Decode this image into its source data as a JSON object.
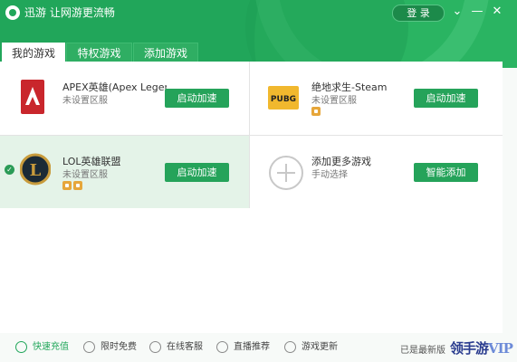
{
  "window": {
    "title": "迅游 让网游更流畅",
    "login_label": "登 录"
  },
  "tabs": [
    {
      "label": "我的游戏",
      "active": true
    },
    {
      "label": "特权游戏",
      "active": false
    },
    {
      "label": "添加游戏",
      "active": false
    }
  ],
  "games": [
    {
      "name": "APEX英雄(Apex Legen...",
      "server": "未设置区服",
      "button": "启动加速",
      "icon": "apex-legends-icon"
    },
    {
      "name": "绝地求生-Steam",
      "server": "未设置区服",
      "button": "启动加速",
      "icon": "pubg-icon",
      "badge_count": 1
    },
    {
      "name": "LOL英雄联盟",
      "server": "未设置区服",
      "button": "启动加速",
      "icon": "league-of-legends-icon",
      "selected": true,
      "badge_count": 2
    },
    {
      "name": "添加更多游戏",
      "server": "手动选择",
      "button": "智能添加",
      "icon": "plus-circle-icon"
    }
  ],
  "footer": {
    "items": [
      {
        "label": "快速充值",
        "icon": "recharge-icon",
        "highlight": true
      },
      {
        "label": "限时免费",
        "icon": "stopwatch-icon"
      },
      {
        "label": "在线客服",
        "icon": "user-service-icon"
      },
      {
        "label": "直播推荐",
        "icon": "live-play-icon"
      },
      {
        "label": "游戏更新",
        "icon": "upload-arrow-icon"
      }
    ],
    "version_status": "已是最新版",
    "watermark": {
      "main": "领手游",
      "suffix": "VIP"
    }
  },
  "colors": {
    "brand_green": "#21a65a",
    "button_green": "#25a35a",
    "selected_bg": "#e4f3e8",
    "badge_gold": "#e6a63a"
  }
}
